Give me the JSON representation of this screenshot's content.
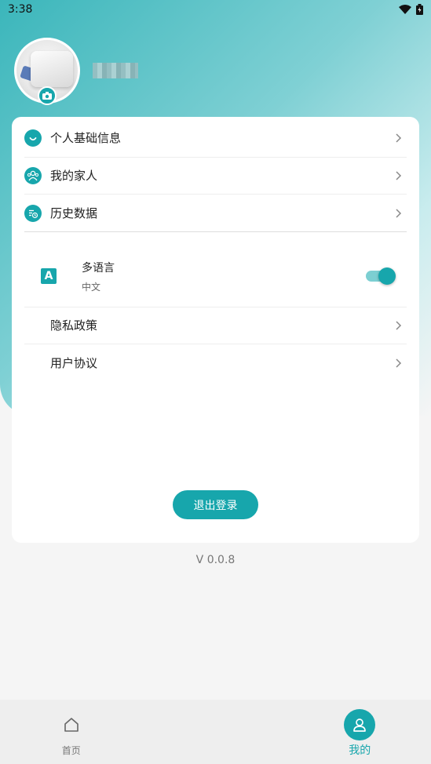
{
  "status_bar": {
    "time": "3:38"
  },
  "profile": {
    "username": "████"
  },
  "menu": {
    "items": [
      {
        "label": "个人基础信息",
        "icon": "smile-icon"
      },
      {
        "label": "我的家人",
        "icon": "family-icon"
      },
      {
        "label": "历史数据",
        "icon": "history-icon"
      }
    ]
  },
  "language": {
    "title": "多语言",
    "current": "中文",
    "icon_letter": "A",
    "enabled": true
  },
  "links": {
    "privacy": "隐私政策",
    "agreement": "用户协议"
  },
  "logout_label": "退出登录",
  "version": "V 0.0.8",
  "tabbar": {
    "home": "首页",
    "me": "我的",
    "active": "me"
  },
  "colors": {
    "accent": "#17a6ac",
    "background": "#f5f5f5"
  }
}
